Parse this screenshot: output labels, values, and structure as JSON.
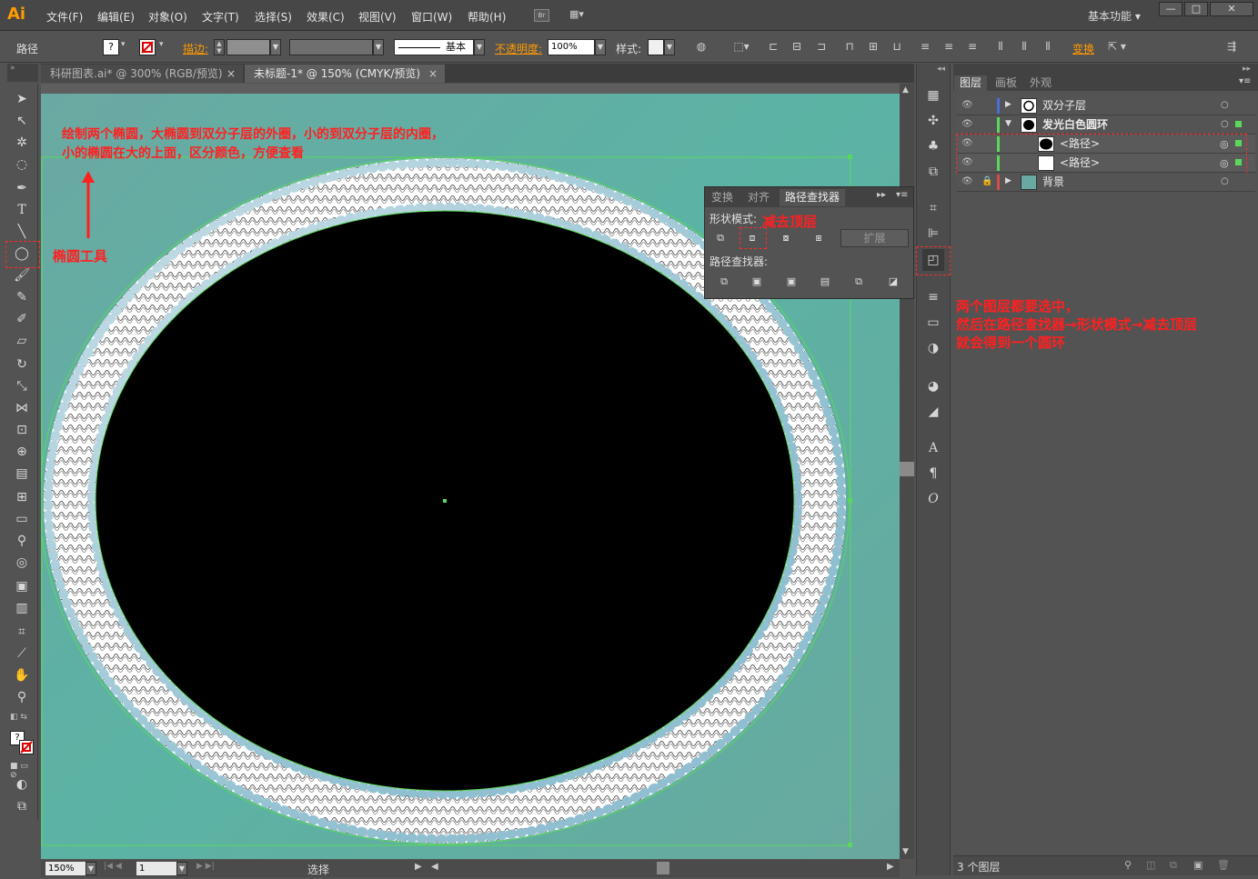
{
  "app": {
    "logo": "Ai",
    "workspace": "基本功能",
    "br": "Br"
  },
  "menu": [
    "文件(F)",
    "编辑(E)",
    "对象(O)",
    "文字(T)",
    "选择(S)",
    "效果(C)",
    "视图(V)",
    "窗口(W)",
    "帮助(H)"
  ],
  "window_controls": {
    "minimize": "—",
    "maximize": "□",
    "close": "✕"
  },
  "control_bar": {
    "selection": "路径",
    "stroke_label": "描边:",
    "stroke_profile": "基本",
    "opacity_label": "不透明度:",
    "opacity_value": "100%",
    "style_label": "样式:",
    "transform_label": "变换",
    "question": "?"
  },
  "tabs": [
    {
      "label": "科研图表.ai* @ 300% (RGB/预览)",
      "close": "×"
    },
    {
      "label": "未标题-1* @ 150% (CMYK/预览)",
      "close": "×"
    }
  ],
  "status_bar": {
    "zoom": "150%",
    "page": "1",
    "mode": "选择"
  },
  "pathfinder": {
    "tabs": [
      "变换",
      "对齐",
      "路径查找器"
    ],
    "shape_modes_label": "形状模式:",
    "expand_label": "扩展",
    "pathfinders_label": "路径查找器:"
  },
  "layers_panel": {
    "tabs": [
      "图层",
      "画板",
      "外观"
    ],
    "rows": [
      {
        "name": "双分子层"
      },
      {
        "name": "发光白色圆环"
      },
      {
        "name": "<路径>"
      },
      {
        "name": "<路径>"
      },
      {
        "name": "背景"
      }
    ],
    "footer": "3 个图层"
  },
  "annotations": {
    "instruction_line1": "绘制两个椭圆，大椭圆到双分子层的外圈，小的到双分子层的内圈，",
    "instruction_line2": "小的椭圆在大的上面，区分颜色，方便查看",
    "ellipse_tool": "椭圆工具",
    "minus_front": "减去顶层",
    "pathfinder_icon": "路径查找器",
    "steps_line1": "两个图层都要选中，",
    "steps_line2": "然后在路径查找器→形状模式→减去顶层",
    "steps_line3": "就会得到一个圆环"
  },
  "colors": {
    "accent": "#ff9a00",
    "annotation": "#ff2020",
    "selection_green": "#5bd85b",
    "layer_blue": "#4a6fd8",
    "layer_red": "#d84a4a"
  }
}
